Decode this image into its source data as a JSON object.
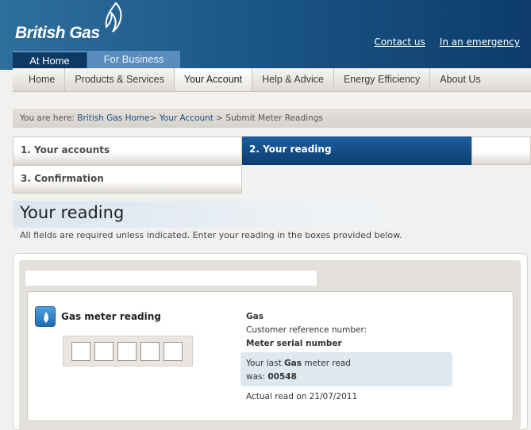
{
  "header": {
    "brand": "British Gas",
    "links": [
      "Contact us",
      "In an emergency"
    ],
    "tabs": [
      "At Home",
      "For Business"
    ]
  },
  "nav": {
    "items": [
      "Home",
      "Products & Services",
      "Your Account",
      "Help & Advice",
      "Energy Efficiency",
      "About Us"
    ],
    "active": "Your Account"
  },
  "breadcrumb": {
    "prefix": "You are here:",
    "home": "British Gas Home",
    "account": "Your Account",
    "current": "Submit Meter Readings"
  },
  "steps": {
    "step1": "1. Your accounts",
    "step2": "2. Your reading",
    "step3": "3. Confirmation"
  },
  "page": {
    "title": "Your reading",
    "intro": "All fields are required unless indicated. Enter your reading in the boxes provided below."
  },
  "meter": {
    "label": "Gas meter reading",
    "icon": "flame-icon",
    "fuel": "Gas",
    "customer_ref_label": "Customer reference number:",
    "serial_label": "Meter serial number",
    "last_read_prefix": "Your last",
    "last_read_fuel": "Gas",
    "last_read_suffix": "meter read",
    "was_label": "was:",
    "last_value": "00548",
    "actual_read": "Actual read on 21/07/2011"
  },
  "colors": {
    "header_blue": "#1b5888",
    "active_step": "#0a3e72",
    "panel_grey": "#e4e0dc"
  }
}
